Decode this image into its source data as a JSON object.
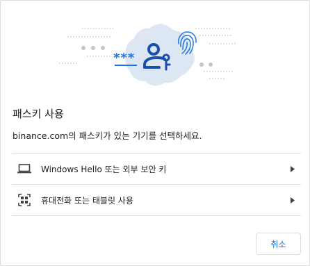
{
  "dialog": {
    "title": "패스키 사용",
    "subtitle": "binance.com의 패스키가 있는 기기를 선택하세요.",
    "options": [
      {
        "label": "Windows Hello 또는 외부 보안 키",
        "icon": "laptop-icon"
      },
      {
        "label": "휴대전화 또는 태블릿 사용",
        "icon": "qr-code-icon"
      }
    ],
    "cancel_label": "취소"
  },
  "hero": {
    "password_mask": "***"
  },
  "colors": {
    "accent": "#1a73e8",
    "blob": "#dce7f3",
    "divider": "#dadce0",
    "text": "#202124"
  }
}
